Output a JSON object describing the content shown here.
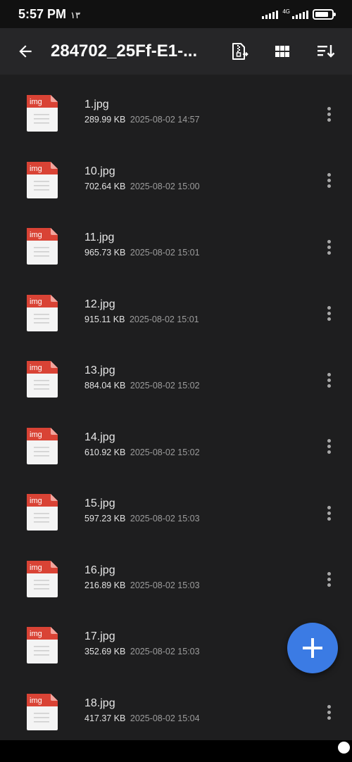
{
  "status_bar": {
    "time": "5:57 PM",
    "extra": "١٣",
    "network_label": "4G"
  },
  "header": {
    "title": "284702_25Ff-E1-...",
    "icons": [
      "arrow-left-icon",
      "zip-export-icon",
      "grid-view-icon",
      "sort-icon"
    ]
  },
  "files": [
    {
      "badge": "img",
      "name": "1.jpg",
      "size": "289.99 KB",
      "date": "2025-08-02 14:57"
    },
    {
      "badge": "img",
      "name": "10.jpg",
      "size": "702.64 KB",
      "date": "2025-08-02 15:00"
    },
    {
      "badge": "img",
      "name": "11.jpg",
      "size": "965.73 KB",
      "date": "2025-08-02 15:01"
    },
    {
      "badge": "img",
      "name": "12.jpg",
      "size": "915.11 KB",
      "date": "2025-08-02 15:01"
    },
    {
      "badge": "img",
      "name": "13.jpg",
      "size": "884.04 KB",
      "date": "2025-08-02 15:02"
    },
    {
      "badge": "img",
      "name": "14.jpg",
      "size": "610.92 KB",
      "date": "2025-08-02 15:02"
    },
    {
      "badge": "img",
      "name": "15.jpg",
      "size": "597.23 KB",
      "date": "2025-08-02 15:03"
    },
    {
      "badge": "img",
      "name": "16.jpg",
      "size": "216.89 KB",
      "date": "2025-08-02 15:03"
    },
    {
      "badge": "img",
      "name": "17.jpg",
      "size": "352.69 KB",
      "date": "2025-08-02 15:03"
    },
    {
      "badge": "img",
      "name": "18.jpg",
      "size": "417.37 KB",
      "date": "2025-08-02 15:04"
    }
  ],
  "colors": {
    "background": "#1e1e1f",
    "app_bar": "#262628",
    "fab": "#3b7be4",
    "file_badge": "#d94335"
  }
}
